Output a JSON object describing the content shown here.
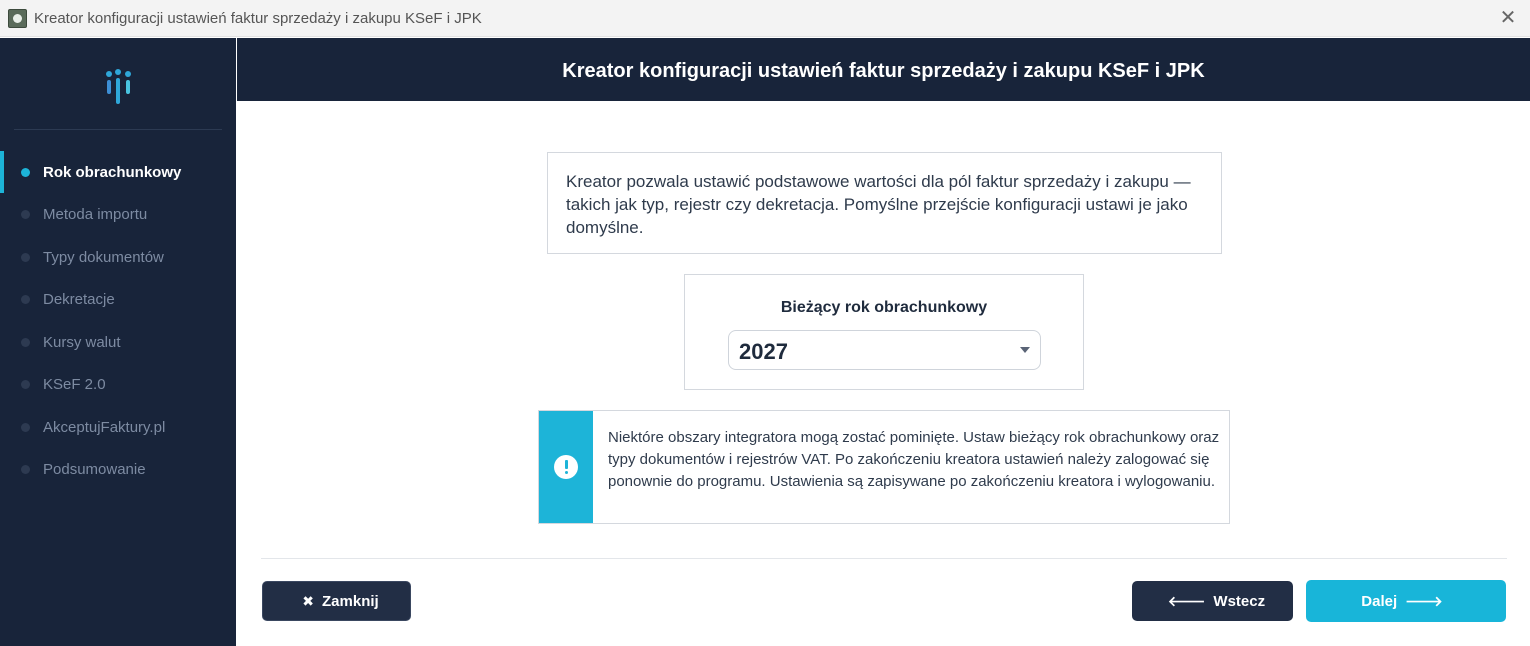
{
  "window": {
    "title": "Kreator konfiguracji ustawień faktur sprzedaży i zakupu KSeF i JPK",
    "close_icon": "close-icon"
  },
  "header": {
    "title": "Kreator konfiguracji ustawień faktur sprzedaży i zakupu KSeF i JPK"
  },
  "sidebar": {
    "logo_icon": "app-logo-icon",
    "active_color": "#1db4d8",
    "items": [
      {
        "label": "Rok obrachunkowy",
        "active": true
      },
      {
        "label": "Metoda importu",
        "active": false
      },
      {
        "label": "Typy dokumentów",
        "active": false
      },
      {
        "label": "Dekretacje",
        "active": false
      },
      {
        "label": "Kursy walut",
        "active": false
      },
      {
        "label": "KSeF 2.0",
        "active": false
      },
      {
        "label": "AkceptujFaktury.pl",
        "active": false
      },
      {
        "label": "Podsumowanie",
        "active": false
      }
    ]
  },
  "main": {
    "intro": "Kreator pozwala ustawić podstawowe wartości dla pól faktur sprzedaży i zakupu — takich jak typ, rejestr czy dekretacja. Pomyślne przejście konfiguracji ustawi je jako domyślne.",
    "year": {
      "label": "Bieżący rok obrachunkowy",
      "value": "2027"
    },
    "notice": {
      "icon": "exclamation-icon",
      "text": "Niektóre obszary integratora mogą zostać pominięte. Ustaw bieżący rok obrachunkowy oraz typy dokumentów i rejestrów VAT. Po zakończeniu kreatora ustawień należy zalogować się ponownie do programu. Ustawienia są zapisywane po zakończeniu kreatora i wylogowaniu."
    }
  },
  "footer": {
    "close_label": "Zamknij",
    "back_label": "Wstecz",
    "next_label": "Dalej",
    "next_color": "#18b5d9",
    "dark_color": "#222e45"
  }
}
